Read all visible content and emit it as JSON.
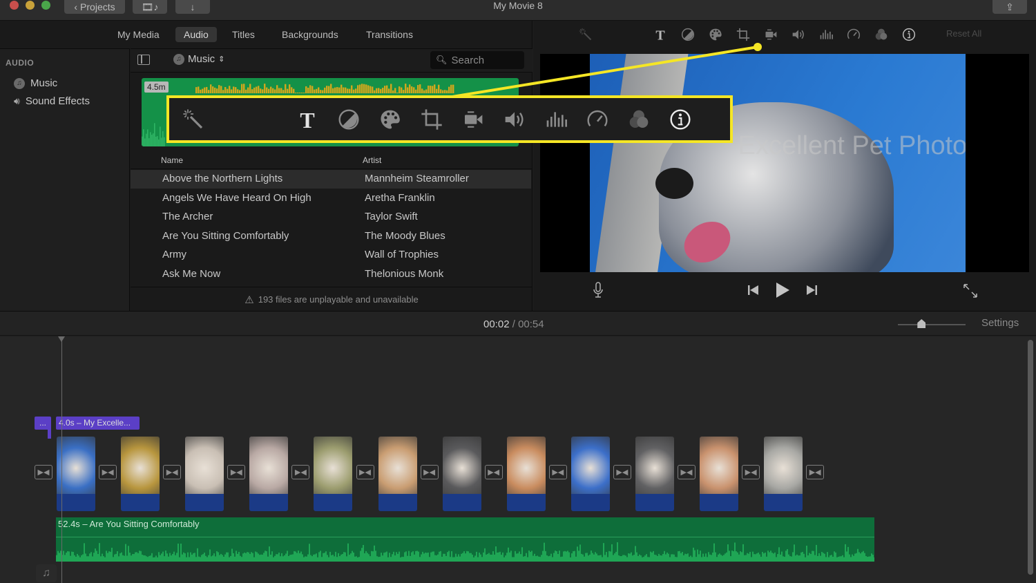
{
  "window": {
    "title": "My Movie 8",
    "projects_label": "Projects",
    "traffic_colors": [
      "#c94f4c",
      "#c9a23a",
      "#4aa64a"
    ]
  },
  "browser": {
    "tabs": [
      {
        "label": "My Media",
        "active": false
      },
      {
        "label": "Audio",
        "active": true
      },
      {
        "label": "Titles",
        "active": false
      },
      {
        "label": "Backgrounds",
        "active": false
      },
      {
        "label": "Transitions",
        "active": false
      }
    ],
    "sidebar": {
      "heading": "AUDIO",
      "items": [
        {
          "label": "Music",
          "icon": "music-disc-icon"
        },
        {
          "label": "Sound Effects",
          "icon": "speaker-icon"
        }
      ]
    },
    "library": {
      "source_label": "Music",
      "search_placeholder": "Search",
      "preview_duration": "4.5m",
      "columns": [
        "Name",
        "Artist"
      ],
      "rows": [
        {
          "name": "Above the Northern Lights",
          "artist": "Mannheim Steamroller",
          "selected": true
        },
        {
          "name": "Angels We Have Heard On High",
          "artist": "Aretha Franklin",
          "selected": false
        },
        {
          "name": "The Archer",
          "artist": "Taylor Swift",
          "selected": false
        },
        {
          "name": "Are You Sitting Comfortably",
          "artist": "The Moody Blues",
          "selected": false
        },
        {
          "name": "Army",
          "artist": "Wall of Trophies",
          "selected": false
        },
        {
          "name": "Ask Me Now",
          "artist": "Thelonious Monk",
          "selected": false
        }
      ],
      "warning": "193 files are unplayable and unavailable"
    }
  },
  "viewer": {
    "toolbar": [
      "magic-wand-icon",
      "title-text-icon",
      "color-balance-icon",
      "color-correction-palette-icon",
      "crop-icon",
      "stabilization-camera-icon",
      "volume-icon",
      "equalizer-icon",
      "speed-gauge-icon",
      "clip-filter-icon",
      "info-icon"
    ],
    "reset_all_label": "Reset All",
    "title_overlay": "Excellent Pet Photos"
  },
  "callout": {
    "color": "#f5e625",
    "icons": [
      "magic-wand-icon",
      "title-text-icon",
      "color-balance-icon",
      "color-correction-palette-icon",
      "crop-icon",
      "stabilization-camera-icon",
      "volume-icon",
      "equalizer-icon",
      "speed-gauge-icon",
      "clip-filter-icon",
      "info-icon"
    ]
  },
  "timeline": {
    "current_time": "00:02",
    "separator": "/",
    "total_time": "00:54",
    "settings_label": "Settings",
    "zoom_level": 0.35,
    "title_clip_small": "...",
    "title_clip": "4.0s – My Excelle...",
    "video_clips": [
      {
        "subject": "dog at monument",
        "color": "#3a6fc4"
      },
      {
        "subject": "food bowl",
        "color": "#b8963e"
      },
      {
        "subject": "white dog",
        "color": "#c9bfb4"
      },
      {
        "subject": "fluffy cat",
        "color": "#b9a9a4"
      },
      {
        "subject": "tabby cat",
        "color": "#9c9d6f"
      },
      {
        "subject": "orange white cat",
        "color": "#c99d72"
      },
      {
        "subject": "gray cat",
        "color": "#5a5a5c"
      },
      {
        "subject": "orange kitten",
        "color": "#c98c5f"
      },
      {
        "subject": "cat with tablet",
        "color": "#3c6fc9"
      },
      {
        "subject": "gray cat 2",
        "color": "#616163"
      },
      {
        "subject": "orange fur",
        "color": "#c9926e"
      },
      {
        "subject": "cats on shelf",
        "color": "#a8a8a4"
      }
    ],
    "music_clip": "52.4s – Are You Sitting Comfortably"
  }
}
